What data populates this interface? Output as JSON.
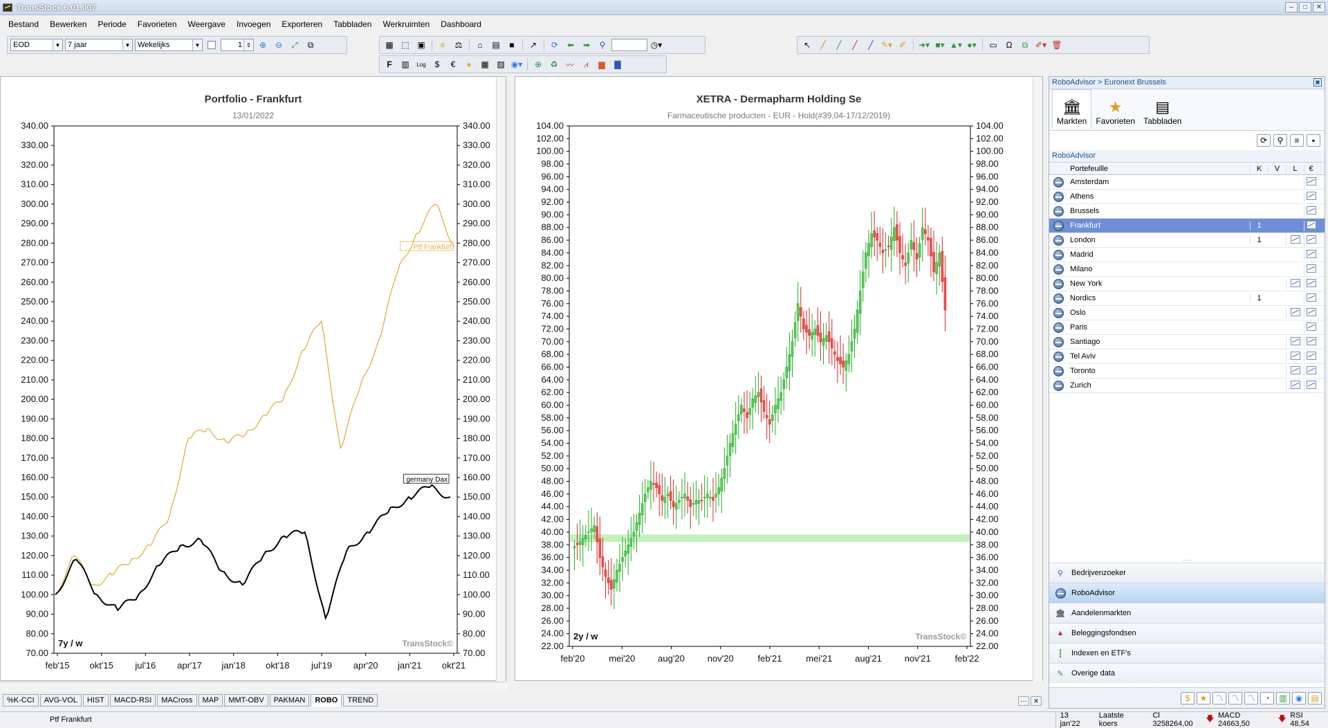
{
  "window": {
    "title": "TransStock 6.01.007"
  },
  "menu": [
    "Bestand",
    "Bewerken",
    "Periode",
    "Favorieten",
    "Weergave",
    "Invoegen",
    "Exporteren",
    "Tabbladen",
    "Werkruimten",
    "Dashboard"
  ],
  "toolbar": {
    "data_type": "EOD",
    "period": "7 jaar",
    "interval": "Wekelijks",
    "count": "1"
  },
  "chart_data": [
    {
      "type": "line",
      "title": "Portfolio - Frankfurt",
      "subtitle": "13/01/2022",
      "x_ticks": [
        "feb'15",
        "okt'15",
        "jul'16",
        "apr'17",
        "jan'18",
        "okt'18",
        "jul'19",
        "apr'20",
        "jan'21",
        "okt'21"
      ],
      "ylim": [
        70,
        340
      ],
      "y_ticks": [
        70,
        80,
        90,
        100,
        110,
        120,
        130,
        140,
        150,
        160,
        170,
        180,
        190,
        200,
        210,
        220,
        230,
        240,
        250,
        260,
        270,
        280,
        290,
        300,
        310,
        320,
        330,
        340
      ],
      "series": [
        {
          "name": "Ptf Frankfurt",
          "color": "#e0b040",
          "values": [
            100,
            120,
            105,
            110,
            118,
            125,
            140,
            180,
            185,
            178,
            182,
            192,
            200,
            225,
            240,
            175,
            205,
            230,
            265,
            285,
            300,
            278
          ]
        },
        {
          "name": "germany Dax",
          "color": "#000000",
          "values": [
            100,
            118,
            100,
            92,
            100,
            115,
            125,
            128,
            112,
            105,
            120,
            130,
            132,
            88,
            122,
            132,
            142,
            150,
            155,
            150
          ]
        }
      ],
      "corner_label": "7y / w",
      "watermark": "TransStock©"
    },
    {
      "type": "candlestick",
      "title": "XETRA - Dermapharm Holding Se",
      "subtitle": "Farmaceutische producten - EUR - Hold(#39,04-17/12/2019)",
      "x_ticks": [
        "feb'20",
        "mei'20",
        "aug'20",
        "nov'20",
        "feb'21",
        "mei'21",
        "aug'21",
        "nov'21",
        "feb'22"
      ],
      "ylim": [
        22,
        104
      ],
      "y_ticks": [
        22,
        24,
        26,
        28,
        30,
        32,
        34,
        36,
        38,
        40,
        42,
        44,
        46,
        48,
        50,
        52,
        54,
        56,
        58,
        60,
        62,
        64,
        66,
        68,
        70,
        72,
        74,
        76,
        78,
        80,
        82,
        84,
        86,
        88,
        90,
        92,
        94,
        96,
        98,
        100,
        102,
        104
      ],
      "hold_level": 39.04,
      "closes": [
        38,
        39,
        40,
        41,
        36,
        33,
        31,
        34,
        36,
        38,
        40,
        43,
        46,
        48,
        47,
        45,
        46,
        44,
        45,
        46,
        44,
        45,
        45,
        46,
        45,
        47,
        50,
        54,
        57,
        60,
        58,
        61,
        62,
        59,
        57,
        60,
        62,
        66,
        70,
        76,
        72,
        71,
        72,
        70,
        71,
        69,
        67,
        66,
        68,
        72,
        78,
        84,
        87,
        86,
        84,
        85,
        88,
        84,
        82,
        86,
        83,
        88,
        86,
        81,
        84,
        75
      ],
      "corner_label": "2y / w",
      "watermark": "TransStock©"
    }
  ],
  "bottom_tabs": [
    "%K-CCI",
    "AVG-VOL",
    "HIST",
    "MACD-RSI",
    "MACross",
    "MAP",
    "MMT-OBV",
    "PAKMAN",
    "ROBO",
    "TREND"
  ],
  "active_tab": "ROBO",
  "right_panel": {
    "breadcrumb": "RoboAdvisor > Euronext Brussels",
    "big_tabs": [
      "Markten",
      "Favorieten",
      "Tabbladen"
    ],
    "section_title": "RoboAdvisor",
    "columns": [
      "Portefeuille",
      "K",
      "V",
      "L",
      "€"
    ],
    "rows": [
      {
        "name": "Amsterdam",
        "k": "",
        "chart": false
      },
      {
        "name": "Athens",
        "k": "",
        "chart": false
      },
      {
        "name": "Brussels",
        "k": "",
        "chart": false
      },
      {
        "name": "Frankfurt",
        "k": "1",
        "chart": false,
        "selected": true
      },
      {
        "name": "London",
        "k": "1",
        "chart": true
      },
      {
        "name": "Madrid",
        "k": "",
        "chart": false
      },
      {
        "name": "Milano",
        "k": "",
        "chart": false
      },
      {
        "name": "New York",
        "k": "",
        "chart": true
      },
      {
        "name": "Nordics",
        "k": "1",
        "chart": false
      },
      {
        "name": "Oslo",
        "k": "",
        "chart": true
      },
      {
        "name": "Paris",
        "k": "",
        "chart": false
      },
      {
        "name": "Santiago",
        "k": "",
        "chart": true
      },
      {
        "name": "Tel Aviv",
        "k": "",
        "chart": true
      },
      {
        "name": "Toronto",
        "k": "",
        "chart": true
      },
      {
        "name": "Zurich",
        "k": "",
        "chart": true
      }
    ],
    "nav": [
      "Bedrijvenzoeker",
      "RoboAdvisor",
      "Aandelenmarkten",
      "Beleggingsfondsen",
      "Indexen en ETF's",
      "Overige data"
    ],
    "nav_active": "RoboAdvisor"
  },
  "status": {
    "left": "Ptf Frankfurt",
    "date": "13 jan'22",
    "laatste": "Laatste koers",
    "cl": "Cl 3258264,00",
    "macd": "MACD 24663,50",
    "rsi": "RSI 48,54"
  }
}
